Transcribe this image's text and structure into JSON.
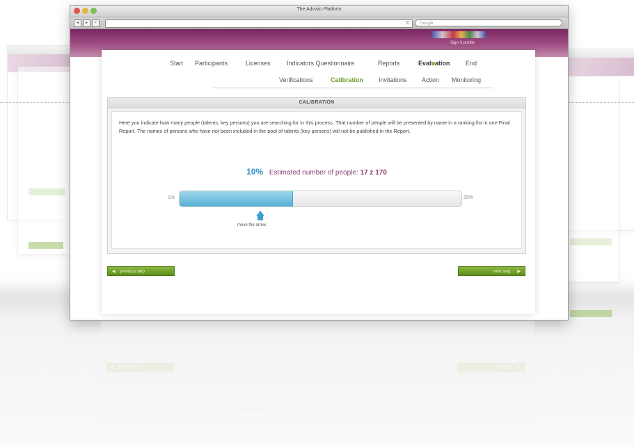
{
  "window": {
    "title": "The Advisio Platform"
  },
  "toolbar": {
    "reload_glyph": "C",
    "search_placeholder": "Google"
  },
  "banner": {
    "user_text": "Sign 3 profile"
  },
  "steps": [
    {
      "label": "Start",
      "active": false
    },
    {
      "label": "Participants",
      "active": false
    },
    {
      "label": "Licenses",
      "active": false
    },
    {
      "label": "Indicators Questionnaire",
      "active": false
    },
    {
      "label": "Reports",
      "active": false
    },
    {
      "label": "Evaluation",
      "active": true
    },
    {
      "label": "End",
      "active": false
    }
  ],
  "substeps": [
    {
      "label": "Verifications",
      "active": false
    },
    {
      "label": "Calibration",
      "active": true
    },
    {
      "label": "Invitations",
      "active": false
    },
    {
      "label": "Action",
      "active": false
    },
    {
      "label": "Monitoring",
      "active": false
    }
  ],
  "calibration": {
    "heading": "CALIBRATION",
    "description": "Here you indicate how many people (talents, key persons) you are searching for in this process. That number of people will be presented by name in a ranking list in one Final Report. The names of persons who have not been included in the pool of talents (key persons) will not be published in the Report.",
    "percent_label": "10%",
    "estimate_label": "Estimated number of people:",
    "estimate_value": "17 z 170",
    "slider": {
      "min_label": "1%",
      "max_label": "25%",
      "min": 1,
      "max": 25,
      "value": 10
    },
    "move_hint": "move the arrow"
  },
  "nav": {
    "previous_label": "previous step",
    "next_label": "next step",
    "prev_icon": "chevron-left-icon",
    "next_icon": "chevron-right-icon"
  },
  "colors": {
    "banner": "#8a3a72",
    "accent_green": "#6f9a2a",
    "slider_blue": "#53b1d6",
    "text_purple": "#8a3f73"
  }
}
